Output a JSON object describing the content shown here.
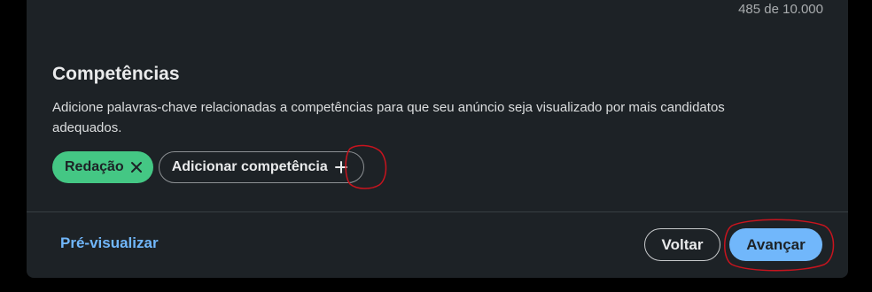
{
  "description_field": {
    "char_count": "485 de 10.000"
  },
  "skills": {
    "title": "Competências",
    "description": "Adicione palavras-chave relacionadas a competências para que seu anúncio seja visualizado por mais candidatos adequados.",
    "selected": [
      {
        "label": "Redação",
        "icon": "close-icon"
      }
    ],
    "add_label": "Adicionar competência",
    "add_icon": "plus-icon"
  },
  "footer": {
    "preview_label": "Pré-visualizar",
    "back_label": "Voltar",
    "next_label": "Avançar"
  },
  "colors": {
    "card_bg": "#1d2226",
    "chip_green": "#44c784",
    "link_blue": "#71b7fb",
    "primary_button": "#71b7fb",
    "annotation_red": "#c8141e"
  }
}
